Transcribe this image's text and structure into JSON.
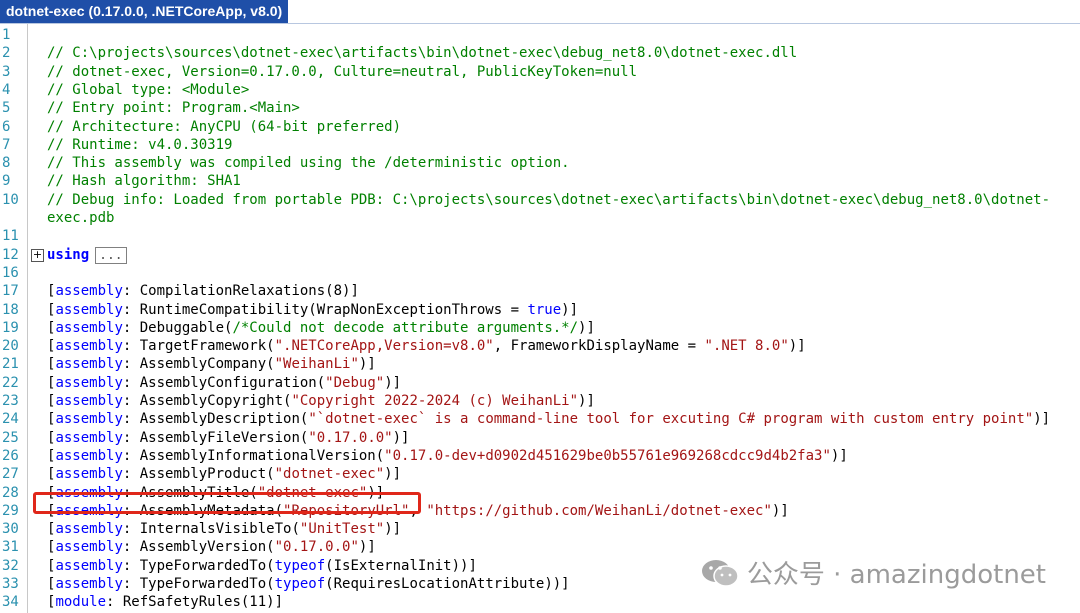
{
  "window": {
    "tab_title": "dotnet-exec (0.17.0.0, .NETCoreApp, v8.0)"
  },
  "lines": [
    {
      "n": "1",
      "segs": []
    },
    {
      "n": "2",
      "segs": [
        [
          "cm",
          "// C:\\projects\\sources\\dotnet-exec\\artifacts\\bin\\dotnet-exec\\debug_net8.0\\dotnet-exec.dll"
        ]
      ]
    },
    {
      "n": "3",
      "segs": [
        [
          "cm",
          "// dotnet-exec, Version=0.17.0.0, Culture=neutral, PublicKeyToken=null"
        ]
      ]
    },
    {
      "n": "4",
      "segs": [
        [
          "cm",
          "// Global type: <Module>"
        ]
      ]
    },
    {
      "n": "5",
      "segs": [
        [
          "cm",
          "// Entry point: Program.<Main>"
        ]
      ]
    },
    {
      "n": "6",
      "segs": [
        [
          "cm",
          "// Architecture: AnyCPU (64-bit preferred)"
        ]
      ]
    },
    {
      "n": "7",
      "segs": [
        [
          "cm",
          "// Runtime: v4.0.30319"
        ]
      ]
    },
    {
      "n": "8",
      "segs": [
        [
          "cm",
          "// This assembly was compiled using the /deterministic option."
        ]
      ]
    },
    {
      "n": "9",
      "segs": [
        [
          "cm",
          "// Hash algorithm: SHA1"
        ]
      ]
    },
    {
      "n": "10",
      "segs": [
        [
          "cm",
          "// Debug info: Loaded from portable PDB: C:\\projects\\sources\\dotnet-exec\\artifacts\\bin\\dotnet-exec\\debug_net8.0\\dotnet-"
        ]
      ]
    },
    {
      "n": "",
      "segs": [
        [
          "cm",
          "exec.pdb"
        ]
      ]
    },
    {
      "n": "11",
      "segs": []
    },
    {
      "n": "12",
      "segs": [
        [
          "kwb",
          "using"
        ]
      ],
      "collapsed": "..."
    },
    {
      "n": "16",
      "segs": []
    },
    {
      "n": "17",
      "segs": [
        [
          "plain",
          "["
        ],
        [
          "kw",
          "assembly"
        ],
        [
          "plain",
          ": CompilationRelaxations(8)]"
        ]
      ]
    },
    {
      "n": "18",
      "segs": [
        [
          "plain",
          "["
        ],
        [
          "kw",
          "assembly"
        ],
        [
          "plain",
          ": RuntimeCompatibility(WrapNonExceptionThrows = "
        ],
        [
          "kw",
          "true"
        ],
        [
          "plain",
          ")]"
        ]
      ]
    },
    {
      "n": "19",
      "segs": [
        [
          "plain",
          "["
        ],
        [
          "kw",
          "assembly"
        ],
        [
          "plain",
          ": Debuggable("
        ],
        [
          "cm",
          "/*Could not decode attribute arguments.*/"
        ],
        [
          "plain",
          ")]"
        ]
      ]
    },
    {
      "n": "20",
      "segs": [
        [
          "plain",
          "["
        ],
        [
          "kw",
          "assembly"
        ],
        [
          "plain",
          ": TargetFramework("
        ],
        [
          "str",
          "\".NETCoreApp,Version=v8.0\""
        ],
        [
          "plain",
          ", FrameworkDisplayName = "
        ],
        [
          "str",
          "\".NET 8.0\""
        ],
        [
          "plain",
          ")]"
        ]
      ]
    },
    {
      "n": "21",
      "segs": [
        [
          "plain",
          "["
        ],
        [
          "kw",
          "assembly"
        ],
        [
          "plain",
          ": AssemblyCompany("
        ],
        [
          "str",
          "\"WeihanLi\""
        ],
        [
          "plain",
          ")]"
        ]
      ]
    },
    {
      "n": "22",
      "segs": [
        [
          "plain",
          "["
        ],
        [
          "kw",
          "assembly"
        ],
        [
          "plain",
          ": AssemblyConfiguration("
        ],
        [
          "str",
          "\"Debug\""
        ],
        [
          "plain",
          ")]"
        ]
      ]
    },
    {
      "n": "23",
      "segs": [
        [
          "plain",
          "["
        ],
        [
          "kw",
          "assembly"
        ],
        [
          "plain",
          ": AssemblyCopyright("
        ],
        [
          "str",
          "\"Copyright 2022-2024 (c) WeihanLi\""
        ],
        [
          "plain",
          ")]"
        ]
      ]
    },
    {
      "n": "24",
      "segs": [
        [
          "plain",
          "["
        ],
        [
          "kw",
          "assembly"
        ],
        [
          "plain",
          ": AssemblyDescription("
        ],
        [
          "str",
          "\"`dotnet-exec` is a command-line tool for excuting C# program with custom entry point\""
        ],
        [
          "plain",
          ")]"
        ]
      ]
    },
    {
      "n": "25",
      "segs": [
        [
          "plain",
          "["
        ],
        [
          "kw",
          "assembly"
        ],
        [
          "plain",
          ": AssemblyFileVersion("
        ],
        [
          "str",
          "\"0.17.0.0\""
        ],
        [
          "plain",
          ")]"
        ]
      ]
    },
    {
      "n": "26",
      "segs": [
        [
          "plain",
          "["
        ],
        [
          "kw",
          "assembly"
        ],
        [
          "plain",
          ": AssemblyInformationalVersion("
        ],
        [
          "str",
          "\"0.17.0-dev+d0902d451629be0b55761e969268cdcc9d4b2fa3\""
        ],
        [
          "plain",
          ")]"
        ]
      ]
    },
    {
      "n": "27",
      "segs": [
        [
          "plain",
          "["
        ],
        [
          "kw",
          "assembly"
        ],
        [
          "plain",
          ": AssemblyProduct("
        ],
        [
          "str",
          "\"dotnet-exec\""
        ],
        [
          "plain",
          ")]"
        ]
      ]
    },
    {
      "n": "28",
      "segs": [
        [
          "plain",
          "["
        ],
        [
          "kw",
          "assembly"
        ],
        [
          "plain",
          ": AssemblyTitle("
        ],
        [
          "str",
          "\"dotnet-exec\""
        ],
        [
          "plain",
          ")]"
        ]
      ]
    },
    {
      "n": "29",
      "segs": [
        [
          "plain",
          "["
        ],
        [
          "kw",
          "assembly"
        ],
        [
          "plain",
          ": AssemblyMetadata("
        ],
        [
          "str",
          "\"RepositoryUrl\""
        ],
        [
          "plain",
          ", "
        ],
        [
          "str",
          "\"https://github.com/WeihanLi/dotnet-exec\""
        ],
        [
          "plain",
          ")]"
        ]
      ]
    },
    {
      "n": "30",
      "segs": [
        [
          "plain",
          "["
        ],
        [
          "kw",
          "assembly"
        ],
        [
          "plain",
          ": InternalsVisibleTo("
        ],
        [
          "str",
          "\"UnitTest\""
        ],
        [
          "plain",
          ")]"
        ]
      ]
    },
    {
      "n": "31",
      "segs": [
        [
          "plain",
          "["
        ],
        [
          "kw",
          "assembly"
        ],
        [
          "plain",
          ": AssemblyVersion("
        ],
        [
          "str",
          "\"0.17.0.0\""
        ],
        [
          "plain",
          ")]"
        ]
      ]
    },
    {
      "n": "32",
      "segs": [
        [
          "plain",
          "["
        ],
        [
          "kw",
          "assembly"
        ],
        [
          "plain",
          ": TypeForwardedTo("
        ],
        [
          "kw",
          "typeof"
        ],
        [
          "plain",
          "(IsExternalInit))]"
        ]
      ]
    },
    {
      "n": "33",
      "segs": [
        [
          "plain",
          "["
        ],
        [
          "kw",
          "assembly"
        ],
        [
          "plain",
          ": TypeForwardedTo("
        ],
        [
          "kw",
          "typeof"
        ],
        [
          "plain",
          "(RequiresLocationAttribute))]"
        ]
      ]
    },
    {
      "n": "34",
      "segs": [
        [
          "plain",
          "["
        ],
        [
          "kw",
          "module"
        ],
        [
          "plain",
          ": RefSafetyRules(11)]"
        ]
      ]
    }
  ],
  "watermark": {
    "text": "公众号 · amazingdotnet"
  },
  "colors": {
    "tab_bg": "#1f4fa8",
    "comment": "#008000",
    "keyword": "#0000ff",
    "string": "#a31515",
    "line_number": "#2b91af",
    "highlight": "#e0271a"
  }
}
